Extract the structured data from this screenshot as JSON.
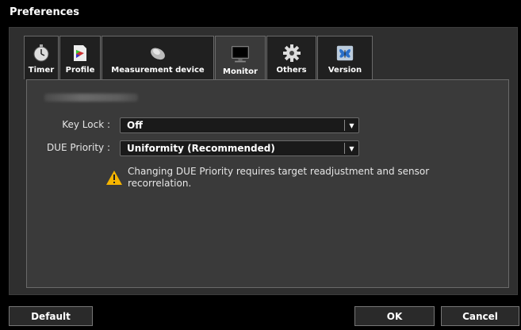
{
  "window": {
    "title": "Preferences"
  },
  "tabs": [
    {
      "label": "Timer",
      "icon": "stopwatch-icon"
    },
    {
      "label": "Profile",
      "icon": "profile-icon"
    },
    {
      "label": "Measurement device",
      "icon": "sensor-icon"
    },
    {
      "label": "Monitor",
      "icon": "monitor-icon",
      "active": true
    },
    {
      "label": "Others",
      "icon": "gear-icon"
    },
    {
      "label": "Version",
      "icon": "butterfly-icon"
    }
  ],
  "monitor": {
    "key_lock": {
      "label": "Key Lock :",
      "value": "Off"
    },
    "due_priority": {
      "label": "DUE Priority :",
      "value": "Uniformity (Recommended)"
    },
    "warning": "Changing DUE Priority requires target readjustment and sensor recorrelation."
  },
  "buttons": {
    "default": "Default",
    "ok": "OK",
    "cancel": "Cancel"
  },
  "colors": {
    "background": "#000000",
    "panel": "#2f2f2f",
    "content": "#3a3a3a",
    "warning": "#f5b400"
  }
}
